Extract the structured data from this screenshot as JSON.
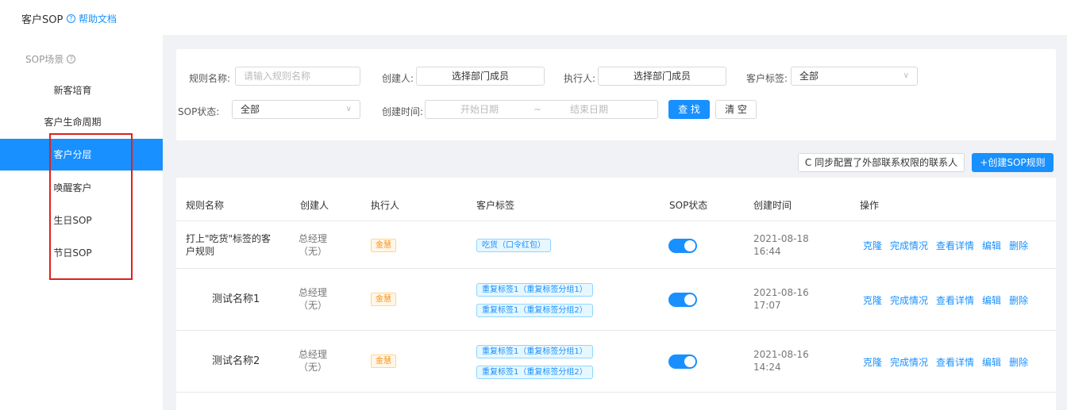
{
  "header": {
    "title": "客户SOP",
    "help_label": "帮助文档"
  },
  "sidebar": {
    "title": "SOP场景",
    "items": [
      {
        "label": "新客培育"
      },
      {
        "label": "客户生命周期"
      },
      {
        "label": "客户分层"
      },
      {
        "label": "唤醒客户"
      },
      {
        "label": "生日SOP"
      },
      {
        "label": "节日SOP"
      }
    ],
    "active_index": 2
  },
  "filter": {
    "rule_name_label": "规则名称:",
    "rule_name_placeholder": "请输入规则名称",
    "creator_label": "创建人:",
    "creator_value": "选择部门成员",
    "executor_label": "执行人:",
    "executor_value": "选择部门成员",
    "tag_label": "客户标签:",
    "tag_value": "全部",
    "status_label": "SOP状态:",
    "status_value": "全部",
    "time_label": "创建时间:",
    "start_date_placeholder": "开始日期",
    "date_separator": "~",
    "end_date_placeholder": "结束日期",
    "search_label": "查 找",
    "clear_label": "清 空"
  },
  "actions": {
    "sync_label": "同步配置了外部联系权限的联系人",
    "create_label": "+创建SOP规则"
  },
  "table": {
    "columns": [
      "规则名称",
      "创建人",
      "执行人",
      "客户标签",
      "SOP状态",
      "创建时间",
      "操作"
    ],
    "rows": [
      {
        "name_line1": "打上\"吃货\"标签的客",
        "name_line2": "户规则",
        "creator_line1": "总经理",
        "creator_line2": "（无）",
        "executor": "金慧",
        "tags": [
          "吃货（口令红包）"
        ],
        "status_on": true,
        "date": "2021-08-18",
        "time": "16:44",
        "ops": [
          "克隆",
          "完成情况",
          "查看详情",
          "编辑",
          "删除"
        ]
      },
      {
        "name": "测试名称1",
        "creator_line1": "总经理",
        "creator_line2": "（无）",
        "executor": "金慧",
        "tags": [
          "重复标签1（重复标签分组1）",
          "重复标签1（重复标签分组2）"
        ],
        "status_on": true,
        "date": "2021-08-16",
        "time": "17:07",
        "ops": [
          "克隆",
          "完成情况",
          "查看详情",
          "编辑",
          "删除"
        ]
      },
      {
        "name": "测试名称2",
        "creator_line1": "总经理",
        "creator_line2": "（无）",
        "executor": "金慧",
        "tags": [
          "重复标签1（重复标签分组1）",
          "重复标签1（重复标签分组2）"
        ],
        "status_on": true,
        "date": "2021-08-16",
        "time": "14:24",
        "ops": [
          "克隆",
          "完成情况",
          "查看详情",
          "编辑",
          "删除"
        ]
      }
    ]
  }
}
